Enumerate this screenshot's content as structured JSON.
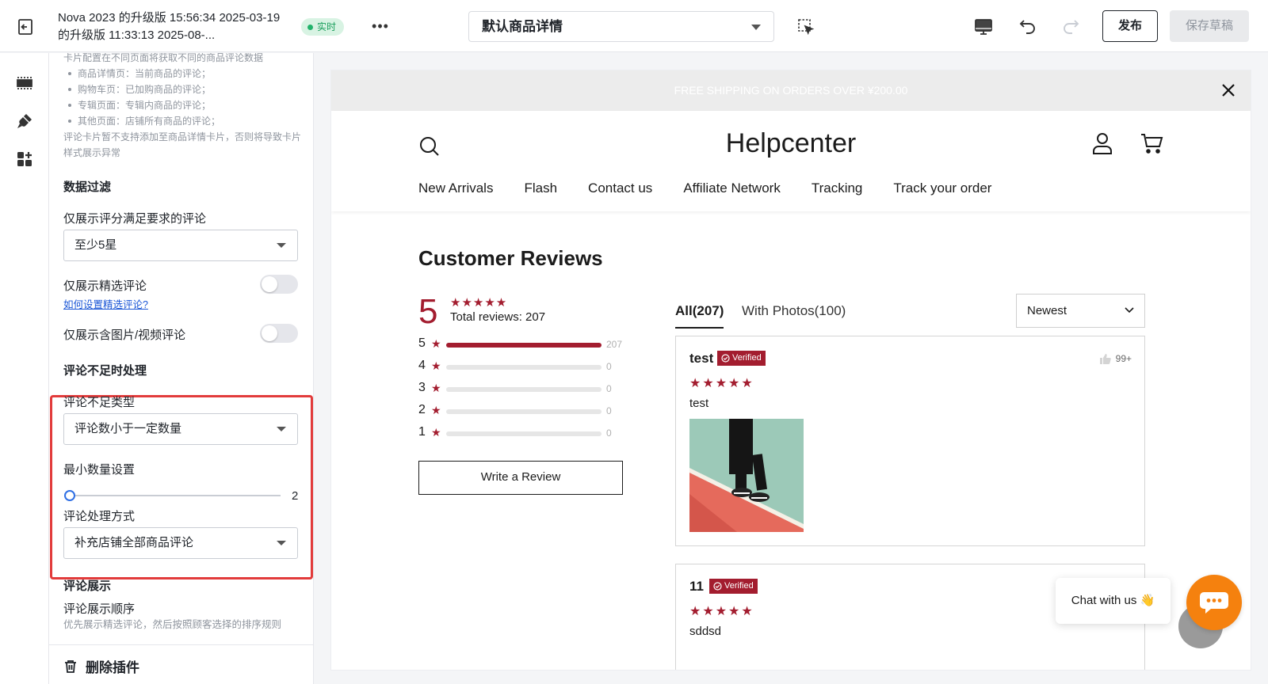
{
  "topbar": {
    "title": "Nova 2023 的升级版 15:56:34 2025-03-19 的升级版 11:33:13 2025-08-...",
    "live_label": "实时",
    "more_label": "•••",
    "page_select_value": "默认商品详情",
    "publish_label": "发布",
    "save_draft_label": "保存草稿"
  },
  "panel": {
    "note_intro": "卡片配置在不同页面将获取不同的商品评论数据",
    "note_items": [
      "商品详情页：当前商品的评论；",
      "购物车页：已加购商品的评论；",
      "专辑页面：专辑内商品的评论；",
      "其他页面：店铺所有商品的评论；"
    ],
    "note_warning": "评论卡片暂不支持添加至商品详情卡片，否则将导致卡片样式展示异常",
    "filter_title": "数据过滤",
    "rating_label": "仅展示评分满足要求的评论",
    "rating_value": "至少5星",
    "featured_label": "仅展示精选评论",
    "featured_link": "如何设置精选评论?",
    "media_label": "仅展示含图片/视频评论",
    "insufficient_title": "评论不足时处理",
    "insufficient_type_label": "评论不足类型",
    "insufficient_type_value": "评论数小于一定数量",
    "min_count_label": "最小数量设置",
    "min_count_value": "2",
    "handling_label": "评论处理方式",
    "handling_value": "补充店铺全部商品评论",
    "display_title": "评论展示",
    "display_order_label": "评论展示顺序",
    "display_order_desc": "优先展示精选评论，然后按照顾客选择的排序规则",
    "delete_label": "删除插件"
  },
  "preview": {
    "announcement": "FREE SHIPPING ON ORDERS OVER ¥200.00",
    "brand": "Helpcenter",
    "nav": [
      "New Arrivals",
      "Flash",
      "Contact us",
      "Affiliate Network",
      "Tracking",
      "Track your order"
    ],
    "reviews_title": "Customer Reviews",
    "score": "5",
    "score_stars": "★★★★★",
    "total_reviews": "Total reviews: 207",
    "distribution": [
      {
        "stars": "5",
        "count": "207",
        "fraction": 1.0
      },
      {
        "stars": "4",
        "count": "0",
        "fraction": 0
      },
      {
        "stars": "3",
        "count": "0",
        "fraction": 0
      },
      {
        "stars": "2",
        "count": "0",
        "fraction": 0
      },
      {
        "stars": "1",
        "count": "0",
        "fraction": 0
      }
    ],
    "star_glyph": "★",
    "write_review_label": "Write a Review",
    "tab_all": "All(207)",
    "tab_photos": "With Photos(100)",
    "sort_value": "Newest",
    "reviews": [
      {
        "name": "test",
        "verified": "Verified",
        "stars": "★★★★★",
        "text": "test",
        "likes": "99+"
      },
      {
        "name": "11",
        "verified": "Verified",
        "stars": "★★★★★",
        "text": "sddsd"
      }
    ],
    "chat_label": "Chat with us 👋"
  },
  "colors": {
    "accent_red": "#a31d2f",
    "highlight_border": "#e23b3b",
    "live_green": "#22b36b",
    "chat_orange": "#f5810e"
  }
}
